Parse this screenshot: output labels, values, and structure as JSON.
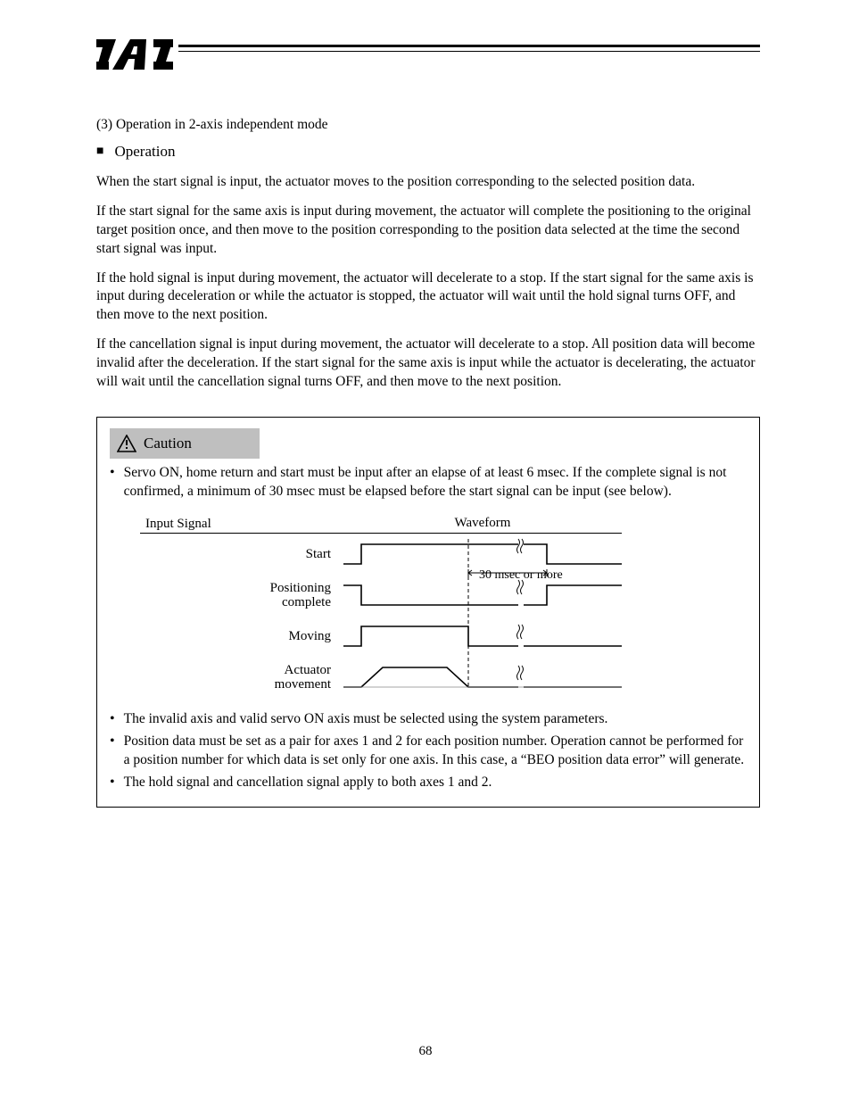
{
  "page": {
    "number": "68"
  },
  "logo_alt": "IAI",
  "section": {
    "lead": "(3)  Operation in 2-axis independent mode",
    "op": {
      "bullet": "■",
      "title": "Operation"
    },
    "p1": "When the start signal is input, the actuator moves to the position corresponding to the selected position data.",
    "p2": "If the start signal for the same axis is input during movement, the actuator will complete the positioning to the original target position once, and then move to the position corresponding to the position data selected at the time the second start signal was input.",
    "p3": "If the hold signal is input during movement, the actuator will decelerate to a stop. If the start signal for the same axis is input during deceleration or while the actuator is stopped, the actuator will wait until the hold signal turns OFF, and then move to the next position.",
    "p4": "If the cancellation signal is input during movement, the actuator will decelerate to a stop. All position data will become invalid after the deceleration. If the start signal for the same axis is input while the actuator is decelerating, the actuator will wait until the cancellation signal turns OFF, and then move to the next position."
  },
  "caution": {
    "label": "Caution",
    "b1": "Servo ON, home return and start must be input after an elapse of at least 6 msec. If the complete signal is not confirmed, a minimum of 30 msec must be elapsed before the start signal can be input (see below).",
    "timing": {
      "header": "Input Signal    Waveform",
      "rows": [
        "Start",
        "Positioning complete",
        "Moving",
        "Actuator movement"
      ],
      "t_complete": "30 msec or more"
    },
    "b2": "The invalid axis and valid servo ON axis must be selected using the system parameters.",
    "b3": "Position data must be set as a pair for axes 1 and 2 for each position number. Operation cannot be performed for a position number for which data is set only for one axis. In this case, a “BEO position data error” will generate.",
    "b4": "The hold signal and cancellation signal apply to both axes 1 and 2."
  }
}
